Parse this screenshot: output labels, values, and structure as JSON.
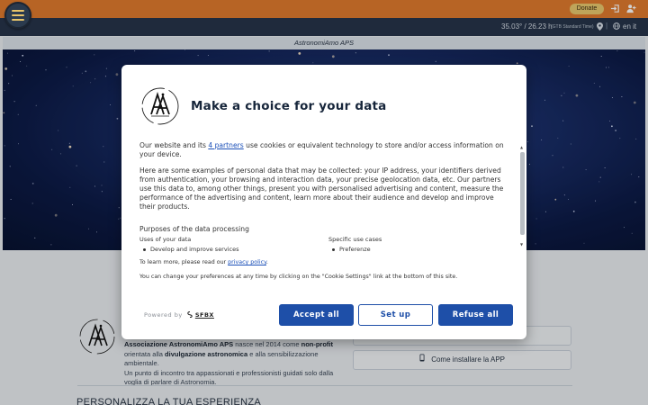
{
  "topbar": {
    "donate_label": "Donate",
    "login_icon": "login-icon",
    "user_icon": "user-add-icon"
  },
  "infobar": {
    "time": "35.03° / 26.23 h",
    "timezone": "(GTB Standard Time)",
    "separator": "|",
    "language": "en it"
  },
  "site": {
    "subtitle": "AstronomiAmo APS"
  },
  "below": {
    "assoc_name": "Associazione AstronomiAmo APS",
    "assoc_text_1": " nasce nel 2014 come ",
    "assoc_nonprofit": "non-profit",
    "assoc_text_2": " orientata alla ",
    "assoc_divulgazione": "divulgazione astronomica",
    "assoc_text_3": " e alla sensibilizzazione ambientale.",
    "assoc_text_4": "Un punto di incontro tra appassionati e professionisti guidati solo dalla voglia di parlare di Astronomia.",
    "install_label": "Come installare la APP",
    "personalizza": "PERSONALIZZA LA TUA ESPERIENZA"
  },
  "consent": {
    "title": "Make a choice for your data",
    "p1_before": "Our website and its ",
    "p1_link": "4 partners",
    "p1_after": " use cookies or equivalent technology to store and/or access information on your device.",
    "p2": "Here are some examples of personal data that may be collected: your IP address, your identifiers derived from authentication, your browsing and interaction data, your precise geolocation data, etc. Our partners use this data to, among other things, present you with personalised advertising and content, measure the performance of the advertising and content, learn more about their audience and develop and improve their products.",
    "purposes_title": "Purposes of the data processing",
    "uses_title": "Uses of your data",
    "uses_item": "Develop and improve services",
    "specific_title": "Specific use cases",
    "specific_item": "Preferenze",
    "learn_before": "To learn more, please read our ",
    "learn_link": "privacy policy",
    "learn_after": ".",
    "change_text": "You can change your preferences at any time by clicking on the \"Cookie Settings\" link at the bottom of this site.",
    "powered_by": "Powered by",
    "sfbx": "SFBX",
    "accept_all": "Accept all",
    "set_up": "Set up",
    "refuse_all": "Refuse all"
  }
}
